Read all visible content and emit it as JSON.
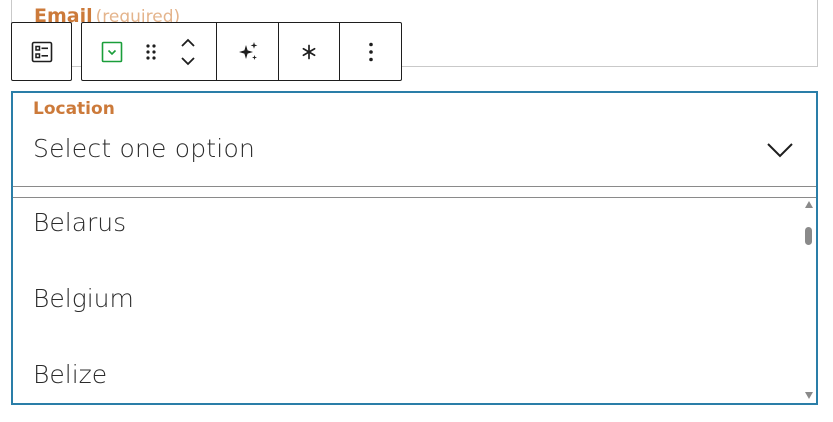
{
  "email_field": {
    "label": "Email",
    "required_label": "(required)"
  },
  "toolbar": {
    "buttons": [
      {
        "name": "form-block-icon"
      },
      {
        "name": "select-block-icon"
      },
      {
        "name": "drag-handle-icon"
      },
      {
        "name": "move-up-down-icon"
      },
      {
        "name": "sparkles-icon"
      },
      {
        "name": "asterisk-icon"
      },
      {
        "name": "more-options-icon"
      }
    ],
    "accent_color": "#1a9e3a"
  },
  "location_field": {
    "label": "Location",
    "value": "Select one option",
    "options": [
      "Belarus",
      "Belgium",
      "Belize"
    ]
  },
  "colors": {
    "label": "#cc7a3a",
    "focus_border": "#2a7ea8"
  }
}
